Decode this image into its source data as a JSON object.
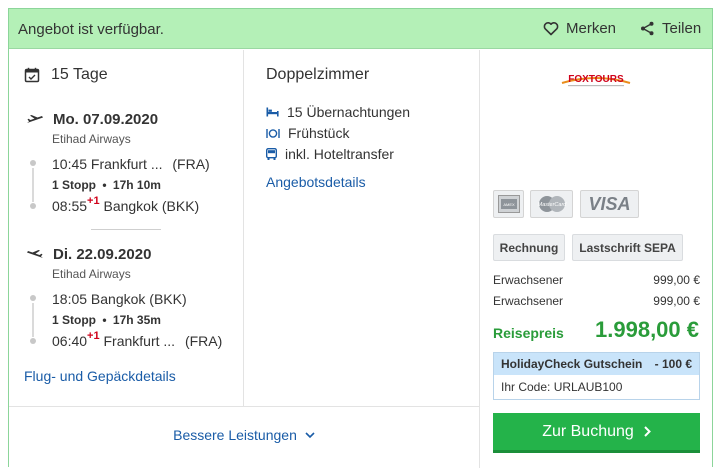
{
  "header": {
    "status": "Angebot ist verfügbar.",
    "save_label": "Merken",
    "share_label": "Teilen"
  },
  "trip": {
    "duration": "15 Tage",
    "outbound": {
      "date": "Mo. 07.09.2020",
      "airline": "Etihad Airways",
      "departure": "10:45 Frankfurt ...",
      "departure_code": "(FRA)",
      "stops": "1 Stopp",
      "travel_time": "17h 10m",
      "arrival_time": "08:55",
      "arrival_offset": "+1",
      "arrival_place": "Bangkok (BKK)"
    },
    "inbound": {
      "date": "Di. 22.09.2020",
      "airline": "Etihad Airways",
      "departure": "18:05 Bangkok (BKK)",
      "stops": "1 Stopp",
      "travel_time": "17h 35m",
      "arrival_time": "06:40",
      "arrival_offset": "+1",
      "arrival_place": "Frankfurt ...",
      "arrival_code": "(FRA)"
    },
    "details_link": "Flug- und Gepäckdetails"
  },
  "room": {
    "title": "Doppelzimmer",
    "features": [
      "15 Übernachtungen",
      "Frühstück",
      "inkl. Hoteltransfer"
    ],
    "details_link": "Angebotsdetails"
  },
  "better_services": "Bessere Leistungen",
  "offer": {
    "provider_logo_text": "FOXTOURS",
    "payment_logos": [
      "AMEX",
      "MasterCard",
      "VISA"
    ],
    "payment_methods": [
      "Rechnung",
      "Lastschrift SEPA"
    ],
    "price_lines": [
      {
        "label": "Erwachsener",
        "value": "999,00 €"
      },
      {
        "label": "Erwachsener",
        "value": "999,00 €"
      }
    ],
    "total_label": "Reisepreis",
    "total_value": "1.998,00 €",
    "voucher": {
      "title": "HolidayCheck Gutschein",
      "discount": "- 100 €",
      "code_text": "Ihr Code: URLAUB100"
    },
    "book_label": "Zur Buchung"
  },
  "colors": {
    "header_bg": "#b4f0b7",
    "accent_green": "#2a9c3a",
    "button_green": "#24b34a",
    "link_blue": "#1a5ca7",
    "voucher_bg": "#c9e4fa"
  }
}
